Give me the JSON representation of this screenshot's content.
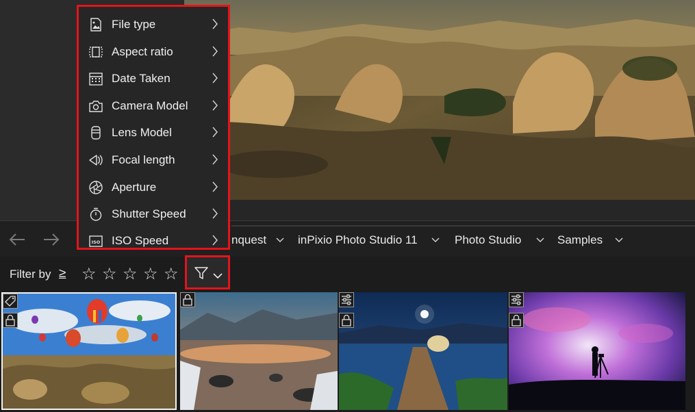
{
  "menu": {
    "items": [
      {
        "label": "File type",
        "icon": "image-file-icon"
      },
      {
        "label": "Aspect ratio",
        "icon": "aspect-ratio-icon"
      },
      {
        "label": "Date Taken",
        "icon": "calendar-icon"
      },
      {
        "label": "Camera Model",
        "icon": "camera-icon"
      },
      {
        "label": "Lens Model",
        "icon": "lens-icon"
      },
      {
        "label": "Focal length",
        "icon": "focal-length-icon"
      },
      {
        "label": "Aperture",
        "icon": "aperture-icon"
      },
      {
        "label": "Shutter Speed",
        "icon": "timer-icon"
      },
      {
        "label": "ISO Speed",
        "icon": "iso-icon"
      }
    ]
  },
  "breadcrumb": {
    "items": [
      "nquest",
      "inPixio Photo Studio 11",
      "Photo Studio",
      "Samples"
    ]
  },
  "filter": {
    "label": "Filter by",
    "operator": "≥",
    "stars": 5,
    "star_glyph": "☆"
  },
  "colors": {
    "highlight": "#e4141b",
    "background": "#1c1c1c"
  }
}
